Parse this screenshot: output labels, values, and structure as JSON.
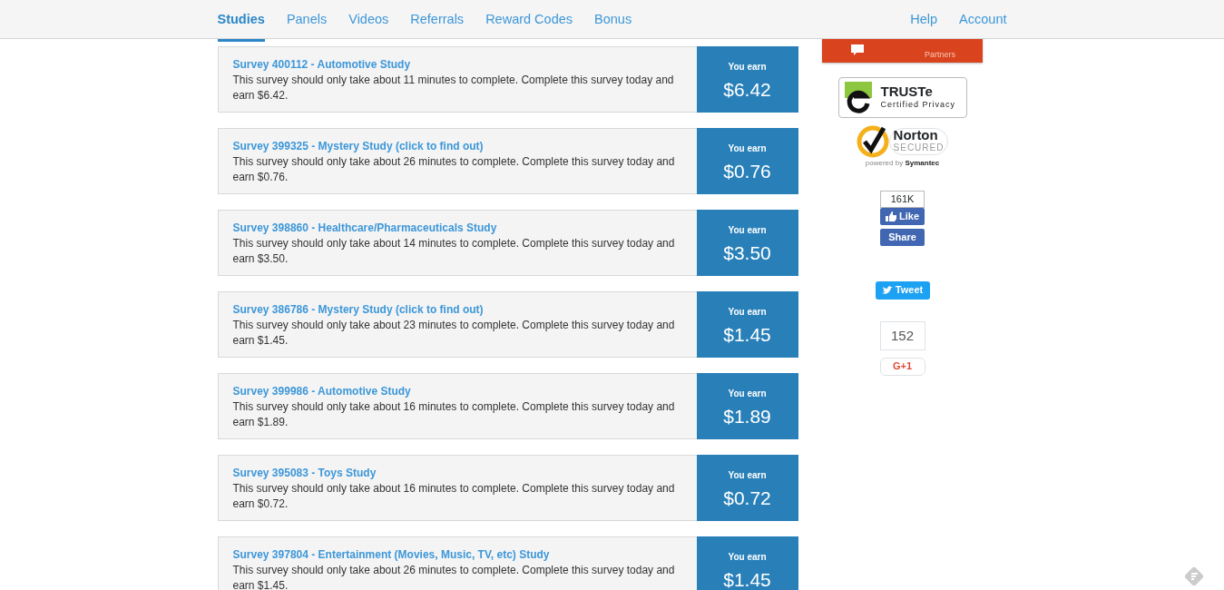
{
  "nav": {
    "left": [
      {
        "label": "Studies",
        "selected": true
      },
      {
        "label": "Panels",
        "selected": false
      },
      {
        "label": "Videos",
        "selected": false
      },
      {
        "label": "Referrals",
        "selected": false
      },
      {
        "label": "Reward Codes",
        "selected": false
      },
      {
        "label": "Bonus",
        "selected": false
      }
    ],
    "right": [
      {
        "label": "Help",
        "selected": false
      },
      {
        "label": "Account",
        "selected": false
      }
    ]
  },
  "surveys": [
    {
      "title": "Survey 400112 - Automotive Study",
      "text": "This survey should only take about 11 minutes to complete. Complete this survey today and earn $6.42.",
      "earn_label": "You earn",
      "amount": "$6.42"
    },
    {
      "title": "Survey 399325 - Mystery Study (click to find out)",
      "text": "This survey should only take about 26 minutes to complete. Complete this survey today and earn $0.76.",
      "earn_label": "You earn",
      "amount": "$0.76"
    },
    {
      "title": "Survey 398860 - Healthcare/Pharmaceuticals Study",
      "text": "This survey should only take about 14 minutes to complete. Complete this survey today and earn $3.50.",
      "earn_label": "You earn",
      "amount": "$3.50"
    },
    {
      "title": "Survey 386786 - Mystery Study (click to find out)",
      "text": "This survey should only take about 23 minutes to complete. Complete this survey today and earn $1.45.",
      "earn_label": "You earn",
      "amount": "$1.45"
    },
    {
      "title": "Survey 399986 - Automotive Study",
      "text": "This survey should only take about 16 minutes to complete. Complete this survey today and earn $1.89.",
      "earn_label": "You earn",
      "amount": "$1.89"
    },
    {
      "title": "Survey 395083 - Toys Study",
      "text": "This survey should only take about 16 minutes to complete. Complete this survey today and earn $0.72.",
      "earn_label": "You earn",
      "amount": "$0.72"
    },
    {
      "title": "Survey 397804 - Entertainment (Movies, Music, TV, etc) Study",
      "text": "This survey should only take about 26 minutes to complete. Complete this survey today and earn $1.45.",
      "earn_label": "You earn",
      "amount": "$1.45"
    }
  ],
  "sidebar": {
    "partner_banner": {
      "text": "Partners"
    },
    "truste": {
      "name": "TRUSTe",
      "caption": "Certified Privacy"
    },
    "norton": {
      "name": "Norton",
      "status": "SECURED",
      "powered_prefix": "powered by",
      "powered_brand": "Symantec"
    },
    "facebook": {
      "count": "161K",
      "like": "Like",
      "share": "Share"
    },
    "twitter": {
      "tweet": "Tweet"
    },
    "google": {
      "count": "152",
      "plus": "G+1"
    }
  }
}
